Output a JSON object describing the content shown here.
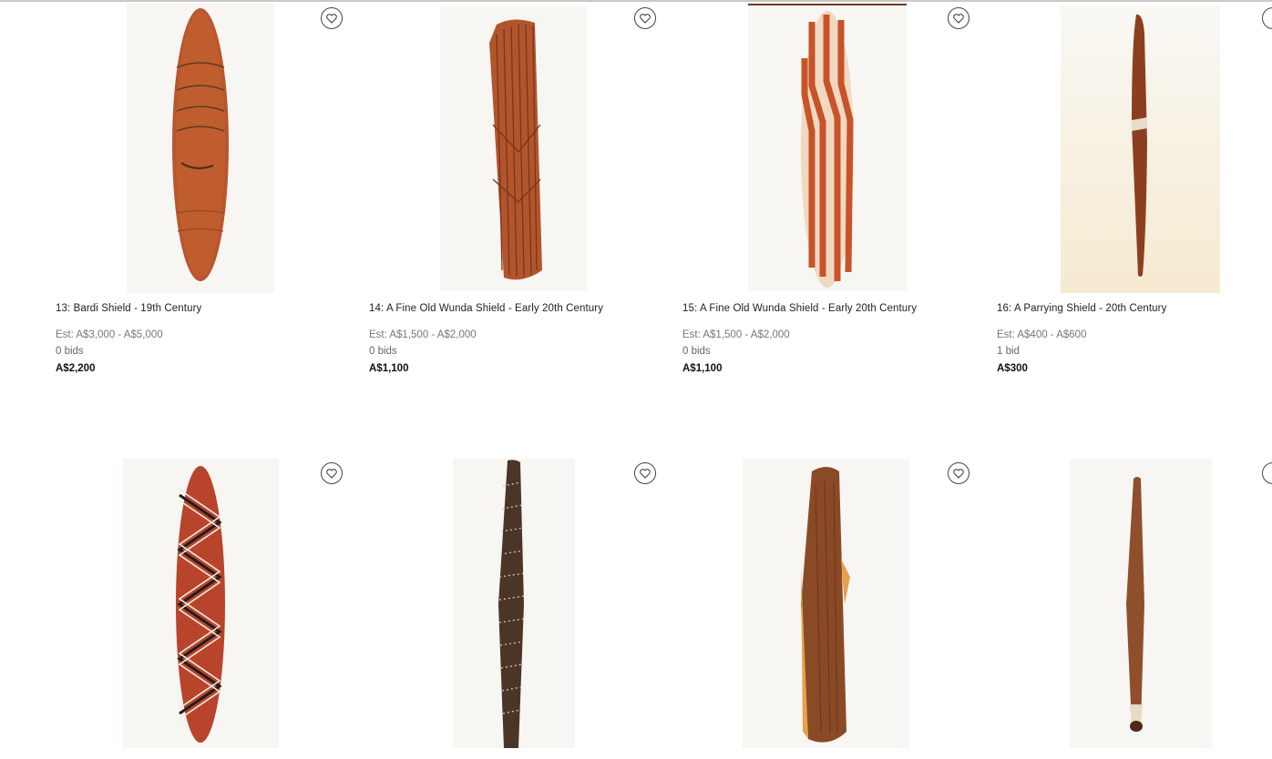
{
  "lots": [
    {
      "title": "13: Bardi Shield - 19th Century",
      "estimate": "Est: A$3,000 - A$5,000",
      "bids": "0 bids",
      "price": "A$2,200",
      "image_icon": "shield-image"
    },
    {
      "title": "14: A Fine Old Wunda Shield - Early 20th Century",
      "estimate": "Est: A$1,500 - A$2,000",
      "bids": "0 bids",
      "price": "A$1,100",
      "image_icon": "shield-image"
    },
    {
      "title": "15: A Fine Old Wunda Shield - Early 20th Century",
      "estimate": "Est: A$1,500 - A$2,000",
      "bids": "0 bids",
      "price": "A$1,100",
      "image_icon": "shield-image"
    },
    {
      "title": "16: A Parrying Shield - 20th Century",
      "estimate": "Est: A$400 - A$600",
      "bids": "1 bid",
      "price": "A$300",
      "image_icon": "shield-image"
    },
    {
      "image_icon": "shield-image"
    },
    {
      "image_icon": "shield-image"
    },
    {
      "image_icon": "shield-image"
    },
    {
      "image_icon": "shield-image"
    }
  ],
  "favorite_icon": "heart-icon",
  "colors": {
    "text": "#222222",
    "muted": "#777777",
    "price": "#111111",
    "shield_red": "#b5522c"
  }
}
